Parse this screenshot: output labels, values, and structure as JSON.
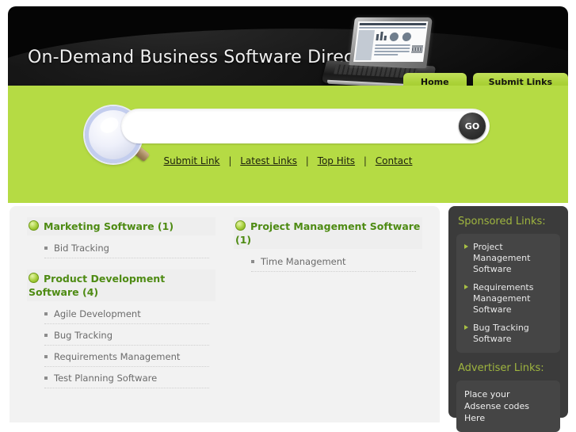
{
  "site": {
    "title": "On-Demand Business Software Directory",
    "tabs": [
      {
        "label": "Home"
      },
      {
        "label": "Submit Links"
      }
    ]
  },
  "search": {
    "value": "",
    "placeholder": "",
    "go_label": "GO"
  },
  "navlinks": [
    {
      "label": "Submit Link"
    },
    {
      "label": "Latest Links"
    },
    {
      "label": "Top Hits"
    },
    {
      "label": "Contact"
    }
  ],
  "separator": "|",
  "categories": {
    "left": [
      {
        "title": "Marketing Software (1)",
        "items": [
          "Bid Tracking"
        ]
      },
      {
        "title": "Product Development Software (4)",
        "items": [
          "Agile Development",
          "Bug Tracking",
          "Requirements Management",
          "Test Planning Software"
        ]
      }
    ],
    "middle": [
      {
        "title": "Project Management Software (1)",
        "items": [
          "Time Management"
        ]
      }
    ]
  },
  "sidebar": {
    "sponsored_heading": "Sponsored Links:",
    "sponsored_links": [
      "Project Management Software",
      "Requirements Management Software",
      "Bug Tracking Software"
    ],
    "advertiser_heading": "Advertiser Links:",
    "advertiser_text": "Place your\nAdsense codes\nHere"
  },
  "colors": {
    "green": "#b5db44",
    "tab_green": "#abd238",
    "header_black": "#050505",
    "category_green": "#4e8b13",
    "sidebar_dark": "#3b3b3b",
    "sidebar_box": "#454545",
    "sidebar_heading": "#9fb53f",
    "content_gray": "#f2f2f2"
  }
}
